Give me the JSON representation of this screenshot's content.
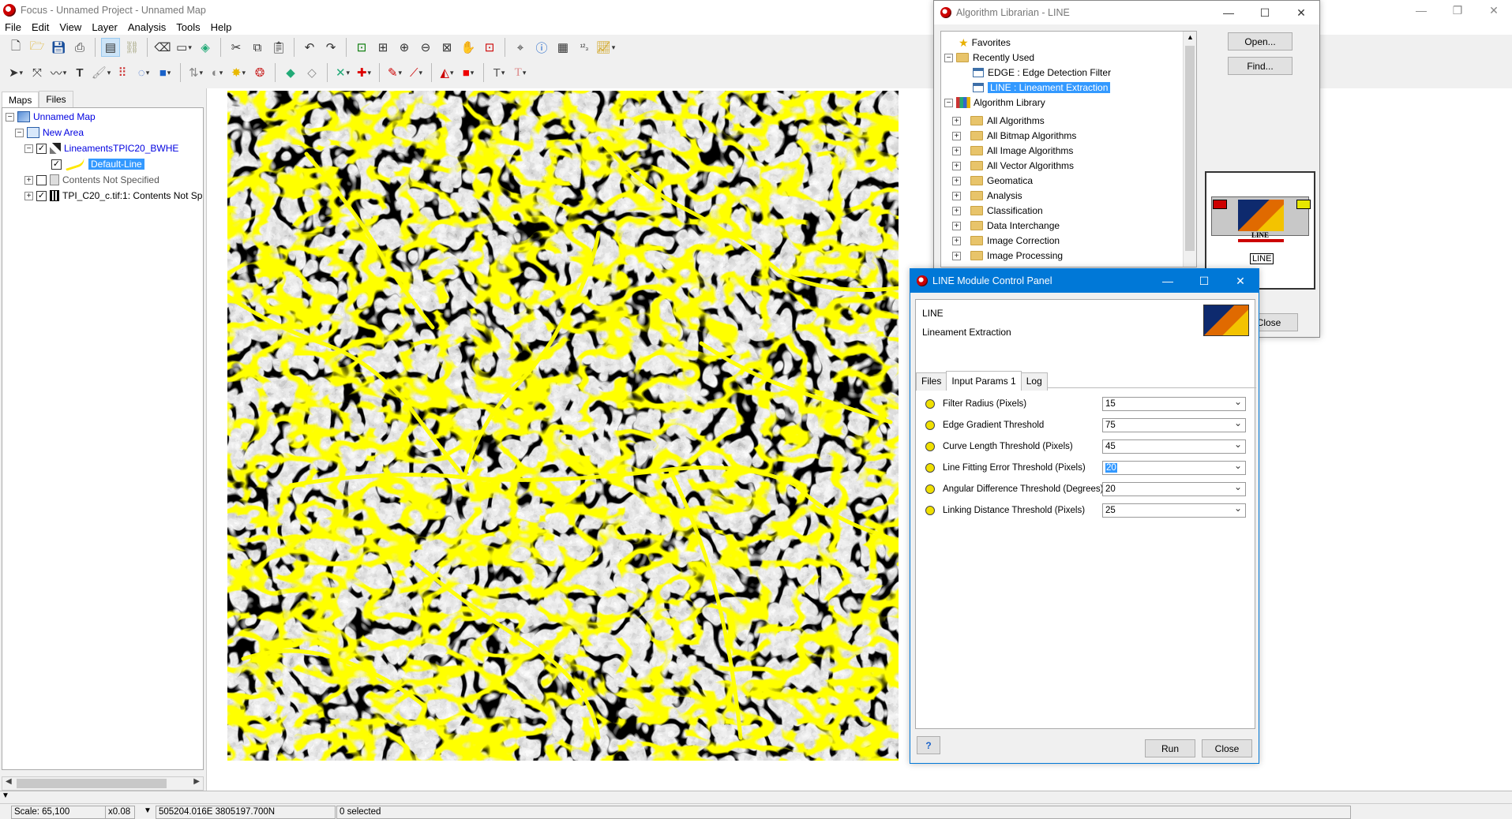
{
  "main_window": {
    "title": "Focus - Unnamed Project - Unnamed Map",
    "controls": {
      "minimize": "—",
      "restore": "❐",
      "close": "✕"
    }
  },
  "menu": [
    "File",
    "Edit",
    "View",
    "Layer",
    "Analysis",
    "Tools",
    "Help"
  ],
  "left_panel": {
    "tabs": [
      "Maps",
      "Files"
    ],
    "active_tab": "Maps",
    "tree": {
      "map": "Unnamed Map",
      "area": "New Area",
      "layer": "LineamentsTPIC20_BWHE",
      "style": "Default-Line",
      "contents": "Contents Not Specified",
      "raster": "TPI_C20_c.tif:1: Contents Not Sp"
    }
  },
  "colors": {
    "lineament": "#ffff00",
    "accent": "#0078d7",
    "selection": "#3399ff"
  },
  "status": {
    "scale": "Scale: 65,100",
    "zoom": "x0.08",
    "coords": "505204.016E 3805197.700N",
    "selected": "0 selected"
  },
  "librarian": {
    "title": "Algorithm Librarian - LINE",
    "tree": {
      "favorites": "Favorites",
      "recently_used": "Recently Used",
      "recent_items": [
        "EDGE : Edge Detection Filter",
        "LINE : Lineament Extraction"
      ],
      "library": "Algorithm Library",
      "library_items": [
        "All Algorithms",
        "All Bitmap Algorithms",
        "All Image Algorithms",
        "All Vector Algorithms",
        "Geomatica",
        "Analysis",
        "Classification",
        "Data Interchange",
        "Image Correction",
        "Image Processing"
      ]
    },
    "buttons": {
      "open": "Open...",
      "find": "Find...",
      "close": "Close"
    },
    "preview": {
      "module_name": "LINE",
      "caption": "LINE"
    }
  },
  "control_panel": {
    "title": "LINE Module Control Panel",
    "module_name": "LINE",
    "module_desc": "Lineament Extraction",
    "tabs": [
      "Files",
      "Input Params 1",
      "Log"
    ],
    "active_tab": "Input Params 1",
    "params": [
      {
        "label": "Filter Radius (Pixels)",
        "value": "15"
      },
      {
        "label": "Edge Gradient Threshold",
        "value": "75"
      },
      {
        "label": "Curve Length Threshold (Pixels)",
        "value": "45"
      },
      {
        "label": "Line Fitting Error Threshold (Pixels)",
        "value": "20"
      },
      {
        "label": "Angular Difference Threshold (Degrees)",
        "value": "20"
      },
      {
        "label": "Linking Distance Threshold (Pixels)",
        "value": "25"
      }
    ],
    "buttons": {
      "run": "Run",
      "close": "Close",
      "help": "?"
    }
  }
}
